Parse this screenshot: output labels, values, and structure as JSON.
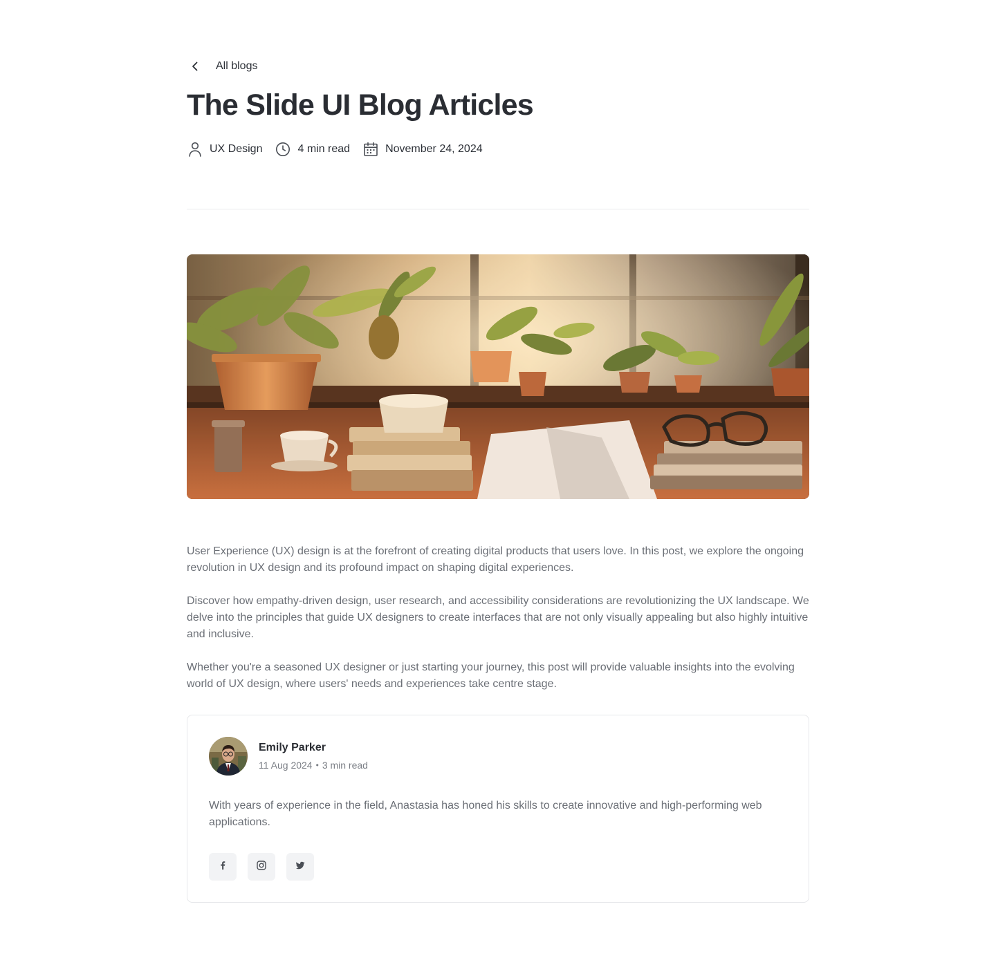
{
  "nav": {
    "back_label": "All blogs"
  },
  "post": {
    "title": "The Slide UI Blog Articles",
    "meta": {
      "category": "UX Design",
      "read_time": "4 min read",
      "date": "November 24, 2024"
    },
    "hero_image_alt": "",
    "paragraphs": [
      "User Experience (UX) design is at the forefront of creating digital products that users love. In this post, we explore the ongoing revolution in UX design and its profound impact on shaping digital experiences.",
      "Discover how empathy-driven design, user research, and accessibility considerations are revolutionizing the UX landscape. We delve into the principles that guide UX designers to create interfaces that are not only visually appealing but also highly intuitive and inclusive.",
      "Whether you're a seasoned UX designer or just starting your journey, this post will provide valuable insights into the evolving world of UX design, where users' needs and experiences take centre stage."
    ]
  },
  "author": {
    "name": "Emily Parker",
    "date": "11 Aug 2024",
    "separator": "•",
    "read_time": "3 min read",
    "bio": "With years of experience in the field, Anastasia has honed his skills to create innovative and high-performing web applications.",
    "socials": [
      {
        "icon": "facebook-icon"
      },
      {
        "icon": "instagram-icon"
      },
      {
        "icon": "twitter-icon"
      }
    ]
  },
  "colors": {
    "text_primary": "#2a2d33",
    "text_muted": "#6b6f76",
    "border": "#e6e7ea",
    "social_bg": "#f2f3f5"
  }
}
